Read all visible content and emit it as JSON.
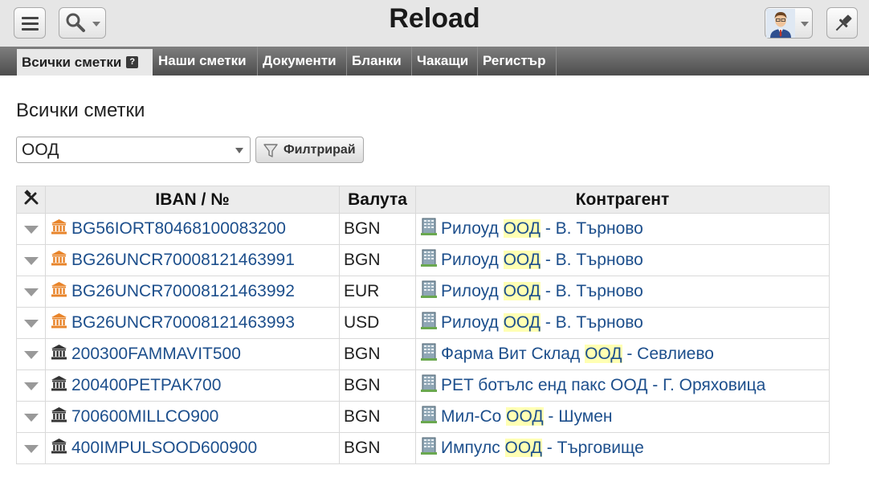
{
  "app": {
    "title": "Reload"
  },
  "tabs": [
    {
      "label": "Всички сметки",
      "active": true,
      "help": "?"
    },
    {
      "label": "Наши сметки"
    },
    {
      "label": "Документи"
    },
    {
      "label": "Бланки"
    },
    {
      "label": "Чакащи"
    },
    {
      "label": "Регистър"
    }
  ],
  "main": {
    "title": "Всички сметки",
    "filter_value": "ООД",
    "filter_button": "Филтрирай"
  },
  "table": {
    "headers": {
      "tools": "tools-icon",
      "iban": "IBAN / №",
      "currency": "Валута",
      "counterparty": "Контрагент"
    },
    "rows": [
      {
        "iban": "BG56IORT80468100083200",
        "currency": "BGN",
        "bank_icon": "bank-icon-orange",
        "cp_before": "Рилоуд ",
        "cp_match": "ООД",
        "cp_after": " - В. Търново"
      },
      {
        "iban": "BG26UNCR70008121463991",
        "currency": "BGN",
        "bank_icon": "bank-icon-orange",
        "cp_before": "Рилоуд ",
        "cp_match": "ООД",
        "cp_after": " - В. Търново"
      },
      {
        "iban": "BG26UNCR70008121463992",
        "currency": "EUR",
        "bank_icon": "bank-icon-orange",
        "cp_before": "Рилоуд ",
        "cp_match": "ООД",
        "cp_after": " - В. Търново"
      },
      {
        "iban": "BG26UNCR70008121463993",
        "currency": "USD",
        "bank_icon": "bank-icon-orange",
        "cp_before": "Рилоуд ",
        "cp_match": "ООД",
        "cp_after": " - В. Търново"
      },
      {
        "iban": "200300FAMMAVIT500",
        "currency": "BGN",
        "bank_icon": "bank-icon-dark",
        "cp_before": "Фарма Вит Склад ",
        "cp_match": "ООД",
        "cp_after": " - Севлиево"
      },
      {
        "iban": "200400PETPAK700",
        "currency": "BGN",
        "bank_icon": "bank-icon-dark",
        "cp_before": "PET ботълс енд пакс ООД - Г. Оряховица",
        "cp_match": "",
        "cp_after": ""
      },
      {
        "iban": "700600MILLCO900",
        "currency": "BGN",
        "bank_icon": "bank-icon-dark",
        "cp_before": "Мил-Со ",
        "cp_match": "ООД",
        "cp_after": " - Шумен"
      },
      {
        "iban": "400IMPULSOOD600900",
        "currency": "BGN",
        "bank_icon": "bank-icon-dark",
        "cp_before": "Импулс ",
        "cp_match": "ООД",
        "cp_after": " - Търговище"
      }
    ]
  },
  "colors": {
    "link": "#1d4f8c",
    "highlight": "#ffffb3",
    "bank_orange": "#e8842a",
    "bank_dark": "#333333"
  }
}
